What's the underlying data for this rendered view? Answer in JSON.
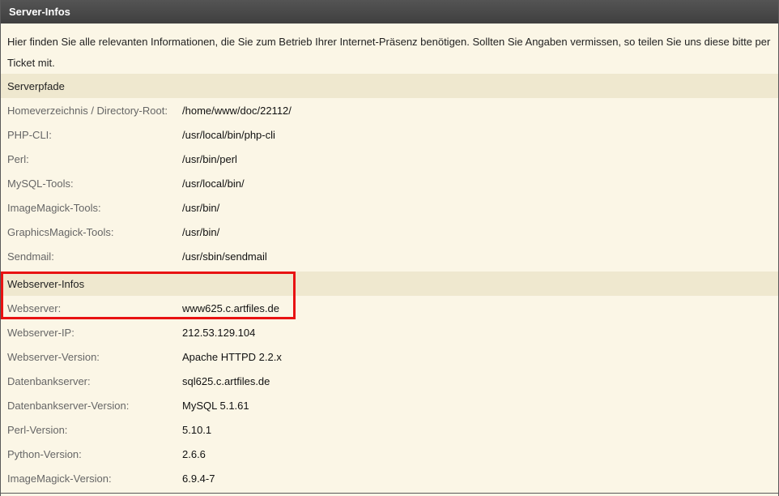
{
  "panel": {
    "title": "Server-Infos",
    "intro": "Hier finden Sie alle relevanten Informationen, die Sie zum Betrieb Ihrer Internet-Präsenz benötigen. Sollten Sie Angaben vermissen, so teilen Sie uns diese bitte per Ticket mit."
  },
  "serverpfade": {
    "heading": "Serverpfade",
    "rows": [
      {
        "label": "Homeverzeichnis / Directory-Root:",
        "value": "/home/www/doc/22112/"
      },
      {
        "label": "PHP-CLI:",
        "value": "/usr/local/bin/php-cli"
      },
      {
        "label": "Perl:",
        "value": "/usr/bin/perl"
      },
      {
        "label": "MySQL-Tools:",
        "value": "/usr/local/bin/"
      },
      {
        "label": "ImageMagick-Tools:",
        "value": "/usr/bin/"
      },
      {
        "label": "GraphicsMagick-Tools:",
        "value": "/usr/bin/"
      },
      {
        "label": "Sendmail:",
        "value": "/usr/sbin/sendmail"
      }
    ]
  },
  "webserver": {
    "heading": "Webserver-Infos",
    "rows": [
      {
        "label": "Webserver:",
        "value": "www625.c.artfiles.de"
      },
      {
        "label": "Webserver-IP:",
        "value": "212.53.129.104"
      },
      {
        "label": "Webserver-Version:",
        "value": "Apache HTTPD 2.2.x"
      },
      {
        "label": "Datenbankserver:",
        "value": "sql625.c.artfiles.de"
      },
      {
        "label": "Datenbankserver-Version:",
        "value": "MySQL 5.1.61"
      },
      {
        "label": "Perl-Version:",
        "value": "5.10.1"
      },
      {
        "label": "Python-Version:",
        "value": "2.6.6"
      },
      {
        "label": "ImageMagick-Version:",
        "value": "6.9.4-7"
      }
    ]
  },
  "colors": {
    "highlight": "#e81212",
    "background": "#fbf6e6",
    "section_background": "#efe8cf",
    "titlebar": "#4a4a4a"
  }
}
